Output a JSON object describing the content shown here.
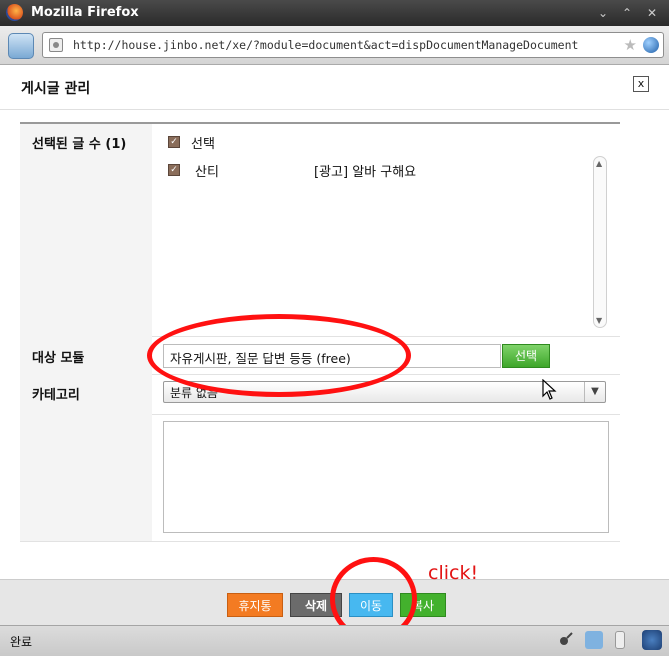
{
  "window": {
    "title": "Mozilla Firefox"
  },
  "address": {
    "url": "http://house.jinbo.net/xe/?module=document&act=dispDocumentManageDocument"
  },
  "modal": {
    "title": "게시글 관리",
    "close_label": "x",
    "selected": {
      "label": "선택된 글 수 (1)",
      "header_label": "선택",
      "items": [
        {
          "author": "산티",
          "subject": "[광고] 알바 구해요"
        }
      ]
    },
    "target_module": {
      "label": "대상 모듈",
      "value": "자유게시판, 질문 답변 등등 (free)",
      "select_button": "선택"
    },
    "category": {
      "label": "카테고리",
      "value": "분류 없음"
    },
    "buttons": {
      "trash": "휴지통",
      "delete": "삭제",
      "move": "이동",
      "copy": "복사"
    }
  },
  "annotation": {
    "text": "click!"
  },
  "status": {
    "text": "완료"
  },
  "colors": {
    "annotation_red": "#ff1111",
    "btn_orange": "#f37b22",
    "btn_gray": "#6b6b6b",
    "btn_blue": "#47b8f0",
    "btn_green": "#43b12d"
  },
  "icons": [
    "firefox-icon",
    "minimize-icon",
    "maximize-icon",
    "close-window-icon",
    "tool-icon",
    "site-icon",
    "bookmark-star-icon",
    "globe-icon",
    "checkbox-icon",
    "scroll-up-icon",
    "scroll-down-icon",
    "chevron-down-icon",
    "mouse-pointer-icon",
    "status-addon-icons"
  ]
}
